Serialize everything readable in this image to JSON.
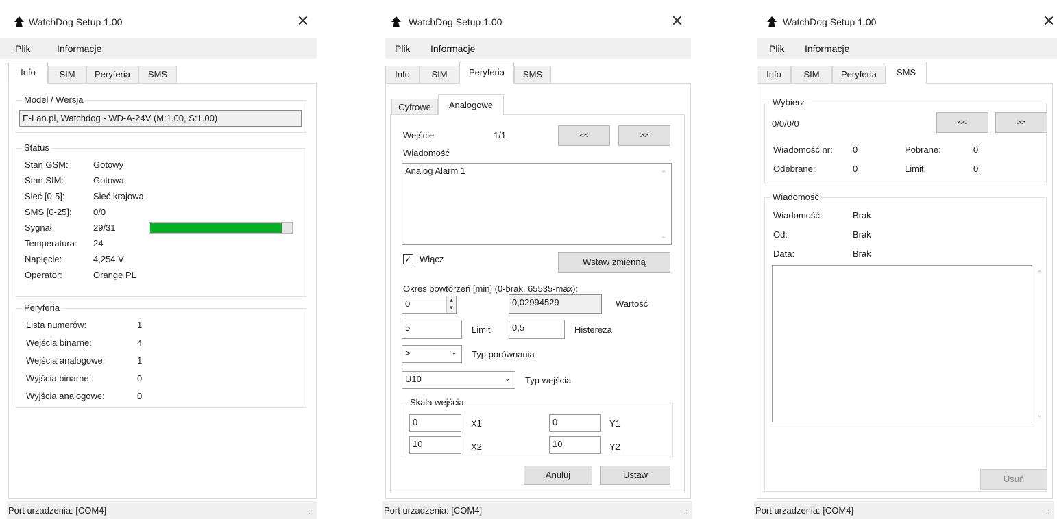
{
  "app": {
    "title": "WatchDog Setup 1.00"
  },
  "menu": {
    "file": "Plik",
    "info": "Informacje"
  },
  "tabs": {
    "info": "Info",
    "sim": "SIM",
    "peripherals": "Peryferia",
    "sms": "SMS"
  },
  "status_bar": {
    "port": "Port urzadzenia: [COM4]"
  },
  "info_tab": {
    "model_group": "Model / Wersja",
    "model_value": "E-Lan.pl, Watchdog - WD-A-24V (M:1.00, S:1.00)",
    "status_group": "Status",
    "status_rows": [
      {
        "label": "Stan GSM:",
        "value": "Gotowy"
      },
      {
        "label": "Stan SIM:",
        "value": "Gotowa"
      },
      {
        "label": "Sieć [0-5]:",
        "value": "Sieć krajowa"
      },
      {
        "label": "SMS [0-25]:",
        "value": "0/0"
      },
      {
        "label": "Sygnał:",
        "value": "29/31"
      },
      {
        "label": "Temperatura:",
        "value": "24"
      },
      {
        "label": "Napięcie:",
        "value": "4,254 V"
      },
      {
        "label": "Operator:",
        "value": "Orange PL"
      }
    ],
    "signal_fraction": 0.935,
    "peripherals_group": "Peryferia",
    "peripheral_rows": [
      {
        "label": "Lista numerów:",
        "value": "1"
      },
      {
        "label": "Wejścia binarne:",
        "value": "4"
      },
      {
        "label": "Wejścia analogowe:",
        "value": "1"
      },
      {
        "label": "Wyjścia binarne:",
        "value": "0"
      },
      {
        "label": "Wyjścia analogowe:",
        "value": "0"
      }
    ]
  },
  "peripherals_tab": {
    "subtabs": {
      "digital": "Cyfrowe",
      "analog": "Analogowe"
    },
    "input_label": "Wejście",
    "input_value": "1/1",
    "prev_button": "<<",
    "next_button": ">>",
    "message_label": "Wiadomość",
    "message_text": "Analog Alarm 1",
    "enable_label": "Włącz",
    "enable_checked": true,
    "insert_variable_button": "Wstaw zmienną",
    "repeat_label": "Okres powtórzeń [min] (0-brak, 65535-max):",
    "repeat_value": "0",
    "current_value": "0,02994529",
    "current_value_label": "Wartość",
    "limit_value": "5",
    "limit_label": "Limit",
    "hysteresis_value": "0,5",
    "hysteresis_label": "Histereza",
    "comparison_value": ">",
    "comparison_label": "Typ porównania",
    "input_type_value": "U10",
    "input_type_label": "Typ wejścia",
    "scale_group": "Skala wejścia",
    "x1_value": "0",
    "x1_label": "X1",
    "y1_value": "0",
    "y1_label": "Y1",
    "x2_value": "10",
    "x2_label": "X2",
    "y2_value": "10",
    "y2_label": "Y2",
    "cancel_button": "Anuluj",
    "set_button": "Ustaw"
  },
  "sms_tab": {
    "select_group": "Wybierz",
    "select_value": "0/0/0/0",
    "prev_button": "<<",
    "next_button": ">>",
    "msg_no_label": "Wiadomość nr:",
    "msg_no_value": "0",
    "downloaded_label": "Pobrane:",
    "downloaded_value": "0",
    "received_label": "Odebrane:",
    "received_value": "0",
    "limit_label": "Limit:",
    "limit_value": "0",
    "message_group": "Wiadomość",
    "msg_label": "Wiadomość:",
    "msg_value": "Brak",
    "from_label": "Od:",
    "from_value": "Brak",
    "date_label": "Data:",
    "date_value": "Brak",
    "delete_button": "Usuń"
  }
}
